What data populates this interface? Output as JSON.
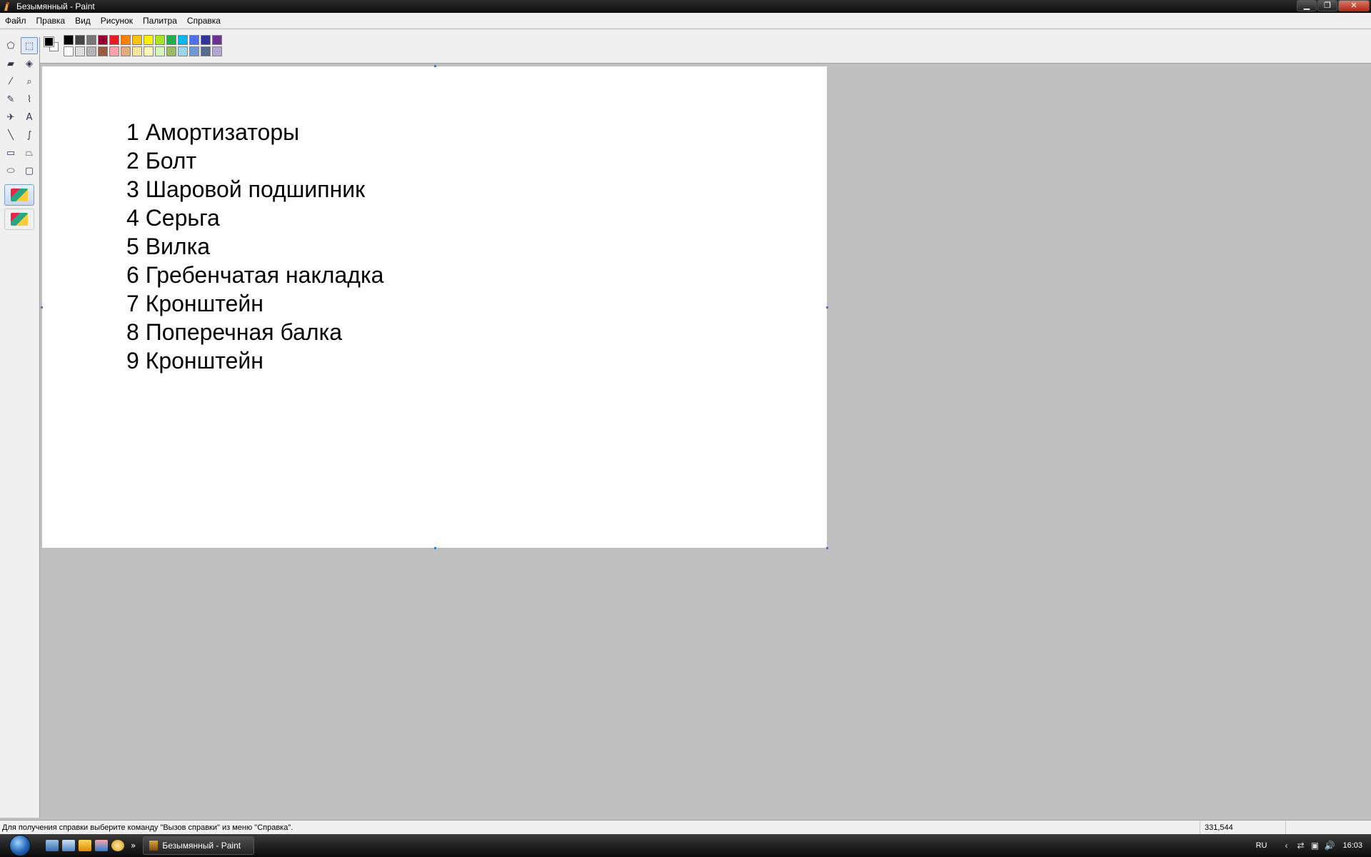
{
  "window": {
    "title": "Безымянный - Paint",
    "controls": {
      "minimize": "▁",
      "maximize": "❐",
      "close": "✕"
    }
  },
  "menu": [
    "Файл",
    "Правка",
    "Вид",
    "Рисунок",
    "Палитра",
    "Справка"
  ],
  "colors": {
    "foreground": "#000000",
    "background": "#ffffff",
    "palette_top": [
      "#000000",
      "#464646",
      "#787878",
      "#990030",
      "#ed1c24",
      "#ff7e00",
      "#ffc20e",
      "#fff200",
      "#a8e61d",
      "#22b14c",
      "#00b7ef",
      "#4d6df3",
      "#2f3699",
      "#6f3198"
    ],
    "palette_bottom": [
      "#ffffff",
      "#dcdcdc",
      "#b4b4b4",
      "#9c5a3c",
      "#ffa3b1",
      "#e5aa7a",
      "#f5e49c",
      "#fff9bd",
      "#d3f9bc",
      "#9dbb61",
      "#99d9ea",
      "#709ad1",
      "#546d8e",
      "#b5a5d5"
    ]
  },
  "tools": [
    {
      "name": "free-select",
      "icon": "⬠"
    },
    {
      "name": "rect-select",
      "icon": "⬚"
    },
    {
      "name": "eraser",
      "icon": "▰"
    },
    {
      "name": "fill",
      "icon": "◈"
    },
    {
      "name": "color-picker",
      "icon": "⁄"
    },
    {
      "name": "magnifier",
      "icon": "⌕"
    },
    {
      "name": "pencil",
      "icon": "✎"
    },
    {
      "name": "brush",
      "icon": "⌇"
    },
    {
      "name": "airbrush",
      "icon": "✈"
    },
    {
      "name": "text",
      "icon": "A"
    },
    {
      "name": "line",
      "icon": "╲"
    },
    {
      "name": "curve",
      "icon": "∫"
    },
    {
      "name": "rectangle",
      "icon": "▭"
    },
    {
      "name": "polygon",
      "icon": "⏢"
    },
    {
      "name": "ellipse",
      "icon": "⬭"
    },
    {
      "name": "rounded-rect",
      "icon": "▢"
    }
  ],
  "canvas": {
    "lines": [
      "1 Амортизаторы",
      "2 Болт",
      "3 Шаровой подшипник",
      "4 Серьга",
      "5 Вилка",
      "6 Гребенчатая накладка",
      "7 Кронштейн",
      "8 Поперечная балка",
      "9 Кронштейн"
    ]
  },
  "status": {
    "help": "Для получения справки выберите команду \"Вызов справки\" из меню \"Справка\".",
    "coords": "331,544"
  },
  "taskbar": {
    "more": "»",
    "task_label": "Безымянный - Paint",
    "lang": "RU",
    "clock": "16:03",
    "tray_expand": "‹"
  }
}
